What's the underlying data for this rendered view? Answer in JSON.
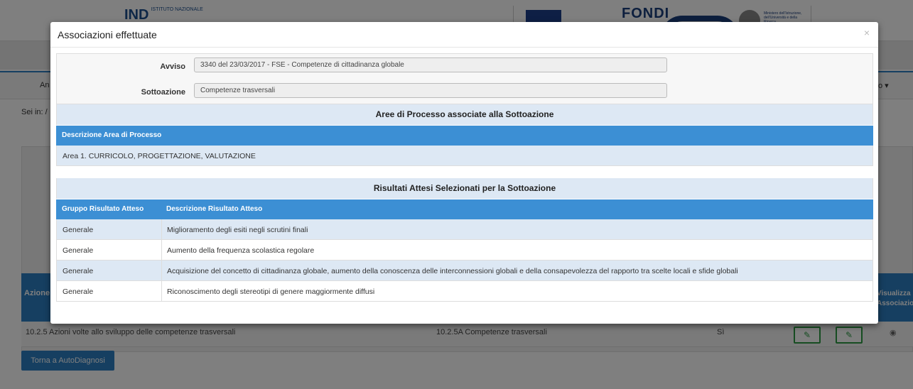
{
  "background": {
    "logo_text": "IND",
    "logo_small": "ISTITUTO NAZIONALE",
    "banner_text": "FONDI",
    "ministry_text": "Ministero dell'Istruzione, dell'Università e della Ricerca",
    "menu_left": "An",
    "menu_right": "o ▾",
    "breadcrumb": "Sei in: /",
    "table_header_left": "Azione",
    "table_header_right": "Visualizza Associazioni",
    "row": {
      "azione": "10.2.5 Azioni volte allo sviluppo delle competenze trasversali",
      "sottoazione": "10.2.5A Competenze trasversali",
      "value": "Sì"
    },
    "back_button": "Torna a AutoDiagnosi",
    "edit_icon": "pencil-icon",
    "view_icon": "eye-icon"
  },
  "modal": {
    "title": "Associazioni effettuate",
    "close_symbol": "×",
    "avviso_label": "Avviso",
    "avviso_value": "3340 del 23/03/2017 - FSE - Competenze di cittadinanza globale",
    "sottoazione_label": "Sottoazione",
    "sottoazione_value": "Competenze trasversali",
    "aree_title": "Aree di Processo associate alla Sottoazione",
    "aree_header": "Descrizione Area di Processo",
    "aree_rows": [
      "Area 1. CURRICOLO, PROGETTAZIONE, VALUTAZIONE"
    ],
    "risultati_title": "Risultati Attesi Selezionati per la Sottoazione",
    "risultati_headers": {
      "gruppo": "Gruppo Risultato Atteso",
      "descrizione": "Descrizione Risultato Atteso"
    },
    "risultati_rows": [
      {
        "gruppo": "Generale",
        "descrizione": "Miglioramento degli esiti negli scrutini finali"
      },
      {
        "gruppo": "Generale",
        "descrizione": "Aumento della frequenza scolastica regolare"
      },
      {
        "gruppo": "Generale",
        "descrizione": "Acquisizione del concetto di cittadinanza globale, aumento della conoscenza delle interconnessioni globali e della consapevolezza del rapporto tra scelte locali e sfide globali"
      },
      {
        "gruppo": "Generale",
        "descrizione": "Riconoscimento degli stereotipi di genere maggiormente diffusi"
      }
    ]
  },
  "colors": {
    "primary": "#2d7fc2",
    "table_header": "#3c8fd4",
    "row_alt": "#dde8f4",
    "edit_green": "#2c9a42"
  }
}
